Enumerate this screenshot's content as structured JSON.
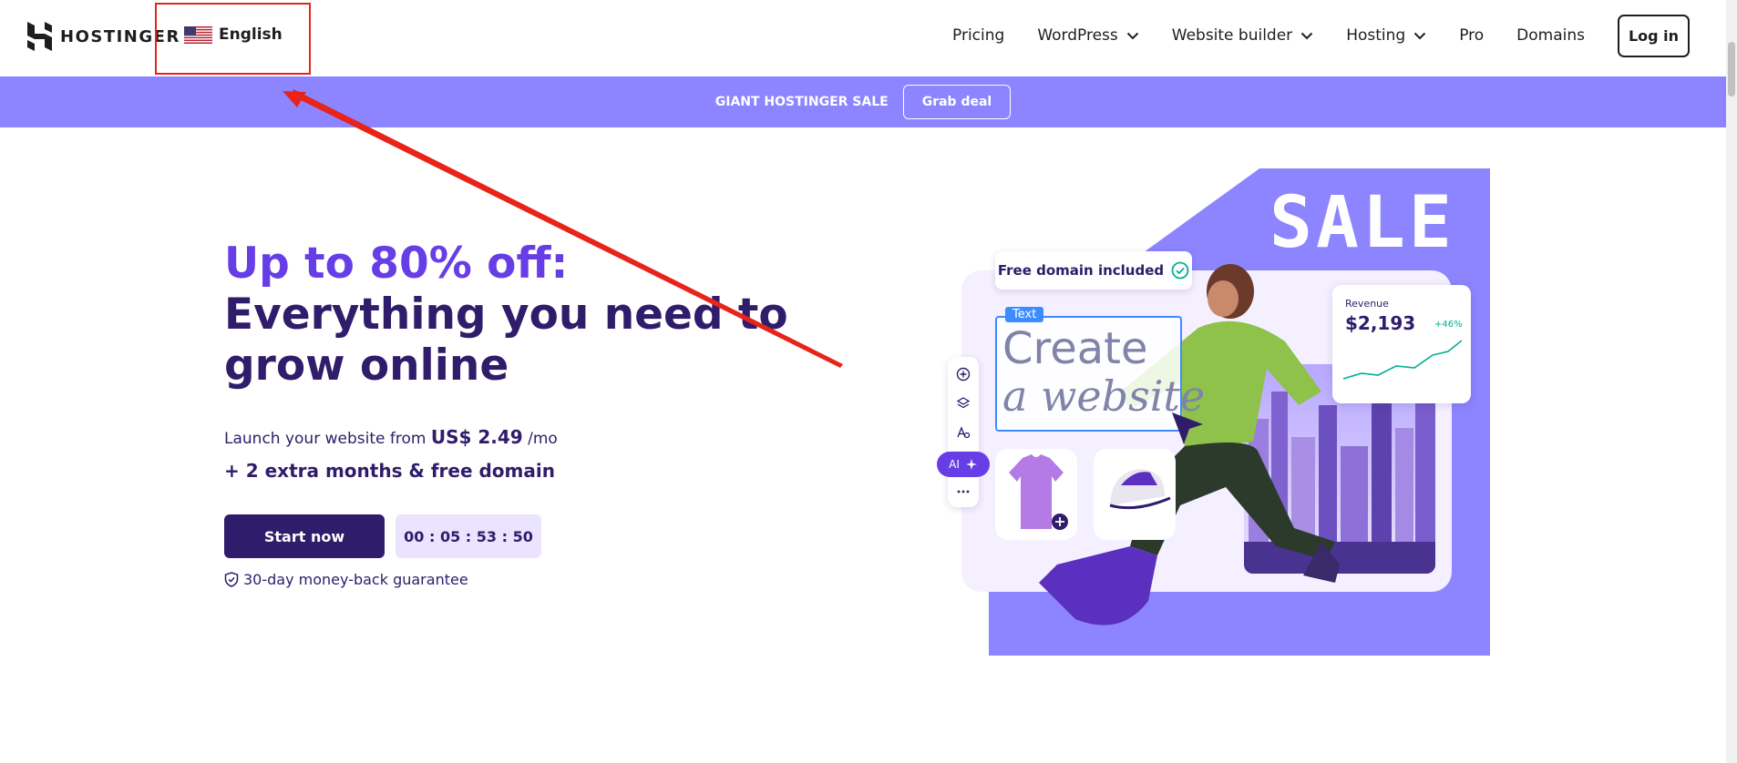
{
  "header": {
    "logo_text": "HOSTINGER",
    "language_label": "English",
    "nav": [
      {
        "label": "Pricing",
        "has_dropdown": false
      },
      {
        "label": "WordPress",
        "has_dropdown": true
      },
      {
        "label": "Website builder",
        "has_dropdown": true
      },
      {
        "label": "Hosting",
        "has_dropdown": true
      },
      {
        "label": "Pro",
        "has_dropdown": false
      },
      {
        "label": "Domains",
        "has_dropdown": false
      }
    ],
    "login_label": "Log in"
  },
  "promo": {
    "text": "GIANT HOSTINGER SALE",
    "button_label": "Grab deal"
  },
  "hero": {
    "title_accent": "Up to 80% off:",
    "title_main": "Everything you need to grow online",
    "price_prefix": "Launch your website from",
    "price": "US$ 2.49",
    "price_suffix": "/mo",
    "extra": "+ 2 extra months & free domain",
    "cta_label": "Start now",
    "timer": "00 : 05 : 53 : 50",
    "guarantee": "30-day money-back guarantee"
  },
  "illustration": {
    "sale_text": "SALE",
    "free_domain": "Free domain included",
    "text_tag": "Text",
    "create_line1": "Create",
    "create_line2": "a website",
    "ai_label": "AI",
    "revenue_label": "Revenue",
    "revenue_value": "$2,193",
    "revenue_delta": "+46%"
  },
  "colors": {
    "brand_purple": "#673de6",
    "dark_purple": "#2f1c6a",
    "promo_bg": "#8c85ff",
    "annotation_red": "#e8231a"
  },
  "icons": [
    "hostinger-logo-icon",
    "us-flag-icon",
    "chevron-down-icon",
    "shield-check-icon",
    "check-circle-icon",
    "plus-circle-icon",
    "layers-icon",
    "text-style-icon",
    "sparkle-icon",
    "more-icon",
    "cursor-icon"
  ]
}
